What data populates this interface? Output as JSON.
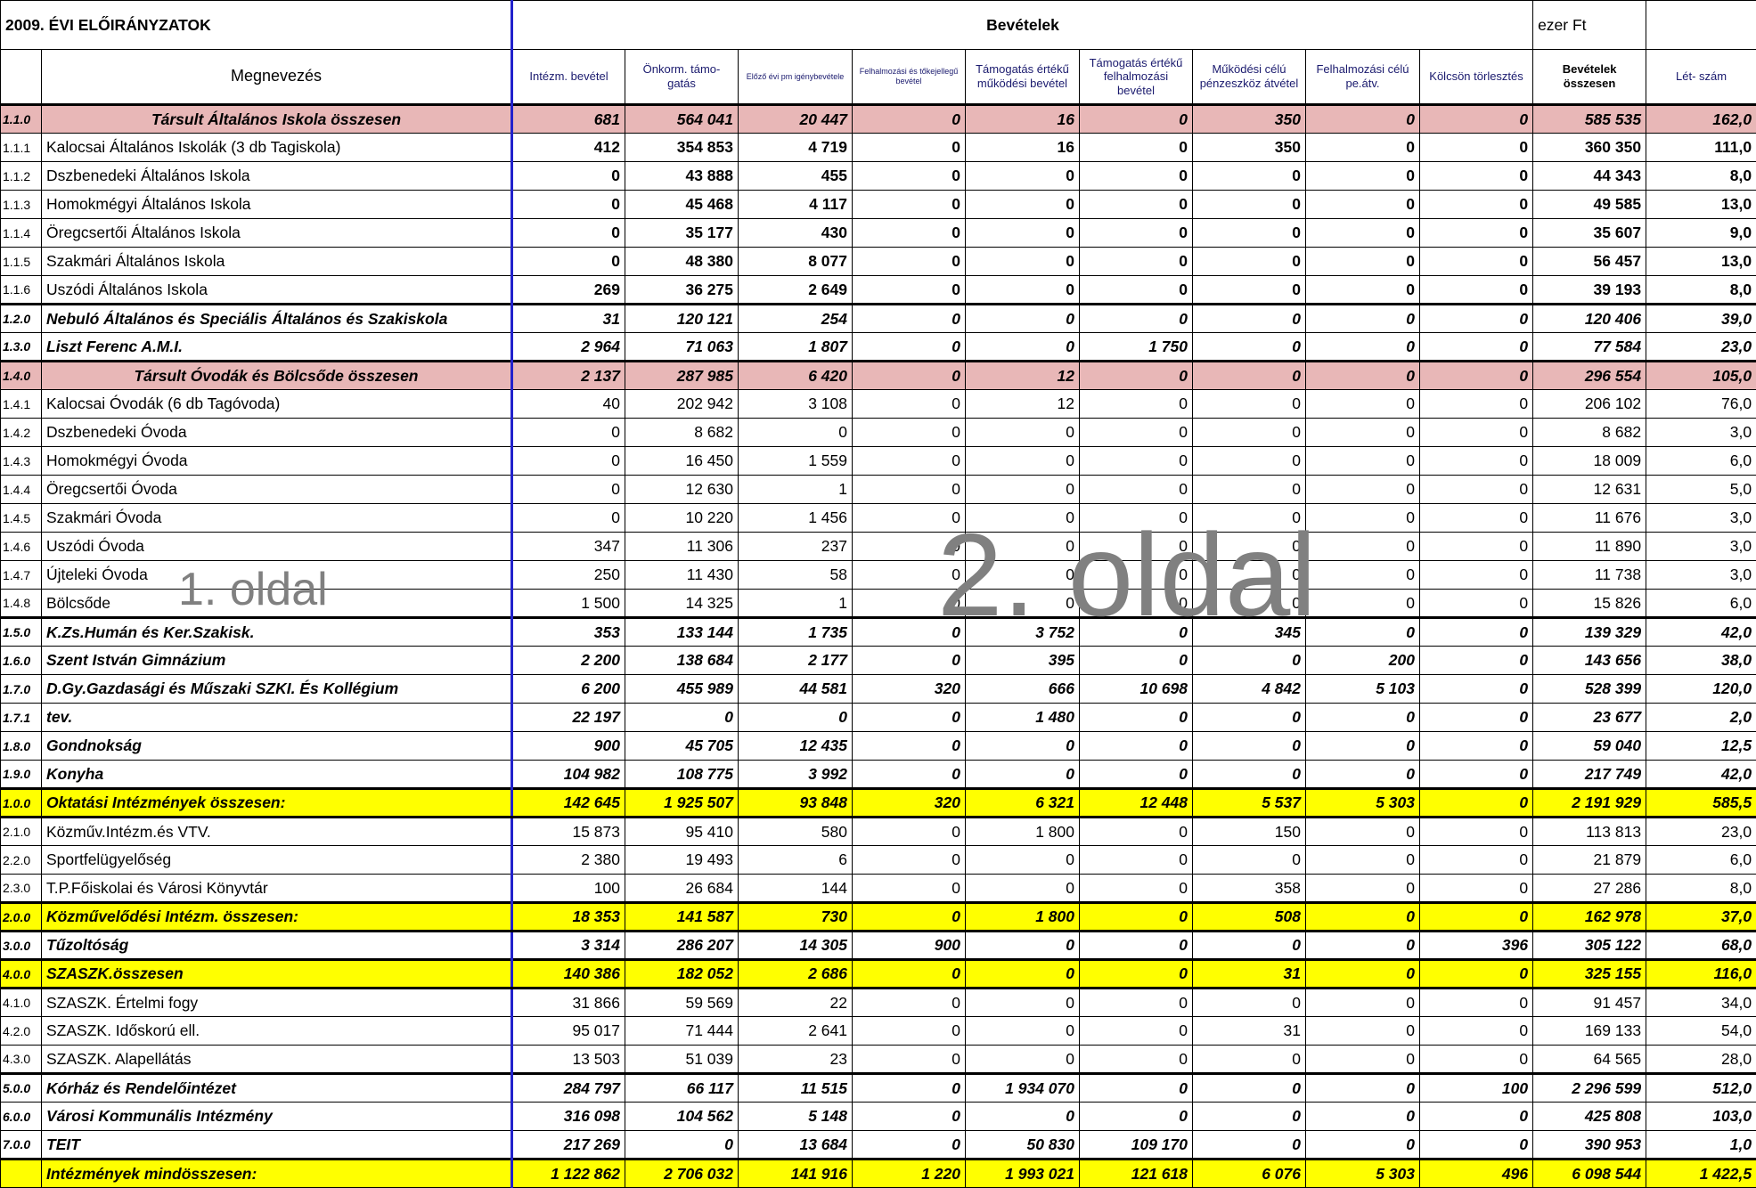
{
  "header": {
    "title": "2009. ÉVI ELŐIRÁNYZATOK",
    "section": "Bevételek",
    "unit": "ezer Ft"
  },
  "columns": {
    "name": "Megnevezés",
    "intezm": "Intézm. bevétel",
    "onkorm": "Önkorm. támo- gatás",
    "elozo": "Előző évi pm igénybevétele",
    "felh_tokejellegu": "Felhalmozási és tőkejellegű bevétel",
    "tam_mukodesi": "Támogatás értékű működési bevétel",
    "tam_felhalmozasi": "Támogatás értékű felhalmozási bevétel",
    "mukodesi_penzeszkoz": "Működési célú pénzeszköz átvétel",
    "felh_pe_atv": "Felhalmozási célú pe.átv.",
    "kolcson": "Kölcsön törlesztés",
    "osszesen": "Bevételek összesen",
    "letszam": "Lét- szám"
  },
  "rows": [
    {
      "code": "1.1.0",
      "name": "Társult Általános Iskola összesen",
      "v": [
        "681",
        "564 041",
        "20 447",
        "0",
        "16",
        "0",
        "350",
        "0",
        "0",
        "585 535",
        "162,0"
      ]
    },
    {
      "code": "1.1.1",
      "name": "Kalocsai Általános Iskolák (3 db Tagiskola)",
      "v": [
        "412",
        "354 853",
        "4 719",
        "0",
        "16",
        "0",
        "350",
        "0",
        "0",
        "360 350",
        "111,0"
      ]
    },
    {
      "code": "1.1.2",
      "name": "Dszbenedeki Általános Iskola",
      "v": [
        "0",
        "43 888",
        "455",
        "0",
        "0",
        "0",
        "0",
        "0",
        "0",
        "44 343",
        "8,0"
      ]
    },
    {
      "code": "1.1.3",
      "name": "Homokmégyi Általános Iskola",
      "v": [
        "0",
        "45 468",
        "4 117",
        "0",
        "0",
        "0",
        "0",
        "0",
        "0",
        "49 585",
        "13,0"
      ]
    },
    {
      "code": "1.1.4",
      "name": "Öregcsertői Általános Iskola",
      "v": [
        "0",
        "35 177",
        "430",
        "0",
        "0",
        "0",
        "0",
        "0",
        "0",
        "35 607",
        "9,0"
      ]
    },
    {
      "code": "1.1.5",
      "name": "Szakmári Általános Iskola",
      "v": [
        "0",
        "48 380",
        "8 077",
        "0",
        "0",
        "0",
        "0",
        "0",
        "0",
        "56 457",
        "13,0"
      ]
    },
    {
      "code": "1.1.6",
      "name": "Uszódi Általános Iskola",
      "v": [
        "269",
        "36 275",
        "2 649",
        "0",
        "0",
        "0",
        "0",
        "0",
        "0",
        "39 193",
        "8,0"
      ]
    },
    {
      "code": "1.2.0",
      "name": "Nebuló Általános és Speciális Általános és Szakiskola",
      "v": [
        "31",
        "120 121",
        "254",
        "0",
        "0",
        "0",
        "0",
        "0",
        "0",
        "120 406",
        "39,0"
      ]
    },
    {
      "code": "1.3.0",
      "name": "Liszt Ferenc A.M.I.",
      "v": [
        "2 964",
        "71 063",
        "1 807",
        "0",
        "0",
        "1 750",
        "0",
        "0",
        "0",
        "77 584",
        "23,0"
      ]
    },
    {
      "code": "1.4.0",
      "name": "Társult Óvodák és Bölcsőde összesen",
      "v": [
        "2 137",
        "287 985",
        "6 420",
        "0",
        "12",
        "0",
        "0",
        "0",
        "0",
        "296 554",
        "105,0"
      ]
    },
    {
      "code": "1.4.1",
      "name": "Kalocsai Óvodák (6 db Tagóvoda)",
      "v": [
        "40",
        "202 942",
        "3 108",
        "0",
        "12",
        "0",
        "0",
        "0",
        "0",
        "206 102",
        "76,0"
      ]
    },
    {
      "code": "1.4.2",
      "name": "Dszbenedeki Óvoda",
      "v": [
        "0",
        "8 682",
        "0",
        "0",
        "0",
        "0",
        "0",
        "0",
        "0",
        "8 682",
        "3,0"
      ]
    },
    {
      "code": "1.4.3",
      "name": "Homokmégyi Óvoda",
      "v": [
        "0",
        "16 450",
        "1 559",
        "0",
        "0",
        "0",
        "0",
        "0",
        "0",
        "18 009",
        "6,0"
      ]
    },
    {
      "code": "1.4.4",
      "name": "Öregcsertői Óvoda",
      "v": [
        "0",
        "12 630",
        "1",
        "0",
        "0",
        "0",
        "0",
        "0",
        "0",
        "12 631",
        "5,0"
      ]
    },
    {
      "code": "1.4.5",
      "name": "Szakmári Óvoda",
      "v": [
        "0",
        "10 220",
        "1 456",
        "0",
        "0",
        "0",
        "0",
        "0",
        "0",
        "11 676",
        "3,0"
      ]
    },
    {
      "code": "1.4.6",
      "name": "Uszódi Óvoda",
      "v": [
        "347",
        "11 306",
        "237",
        "0",
        "0",
        "0",
        "0",
        "0",
        "0",
        "11 890",
        "3,0"
      ]
    },
    {
      "code": "1.4.7",
      "name": "Újteleki Óvoda",
      "v": [
        "250",
        "11 430",
        "58",
        "0",
        "0",
        "0",
        "0",
        "0",
        "0",
        "11 738",
        "3,0"
      ]
    },
    {
      "code": "1.4.8",
      "name": "Bölcsőde",
      "v": [
        "1 500",
        "14 325",
        "1",
        "0",
        "0",
        "0",
        "0",
        "0",
        "0",
        "15 826",
        "6,0"
      ]
    },
    {
      "code": "1.5.0",
      "name": "K.Zs.Humán és Ker.Szakisk.",
      "v": [
        "353",
        "133 144",
        "1 735",
        "0",
        "3 752",
        "0",
        "345",
        "0",
        "0",
        "139 329",
        "42,0"
      ]
    },
    {
      "code": "1.6.0",
      "name": "Szent István Gimnázium",
      "v": [
        "2 200",
        "138 684",
        "2 177",
        "0",
        "395",
        "0",
        "0",
        "200",
        "0",
        "143 656",
        "38,0"
      ]
    },
    {
      "code": "1.7.0",
      "name": "D.Gy.Gazdasági és Műszaki SZKI. És Kollégium",
      "v": [
        "6 200",
        "455 989",
        "44 581",
        "320",
        "666",
        "10 698",
        "4 842",
        "5 103",
        "0",
        "528 399",
        "120,0"
      ]
    },
    {
      "code": "1.7.1",
      "name": "tev.",
      "v": [
        "22 197",
        "0",
        "0",
        "0",
        "1 480",
        "0",
        "0",
        "0",
        "0",
        "23 677",
        "2,0"
      ]
    },
    {
      "code": "1.8.0",
      "name": "Gondnokság",
      "v": [
        "900",
        "45 705",
        "12 435",
        "0",
        "0",
        "0",
        "0",
        "0",
        "0",
        "59 040",
        "12,5"
      ]
    },
    {
      "code": "1.9.0",
      "name": "Konyha",
      "v": [
        "104 982",
        "108 775",
        "3 992",
        "0",
        "0",
        "0",
        "0",
        "0",
        "0",
        "217 749",
        "42,0"
      ]
    },
    {
      "code": "1.0.0",
      "name": "Oktatási Intézmények összesen:",
      "v": [
        "142 645",
        "1 925 507",
        "93 848",
        "320",
        "6 321",
        "12 448",
        "5 537",
        "5 303",
        "0",
        "2 191 929",
        "585,5"
      ]
    },
    {
      "code": "2.1.0",
      "name": "Közműv.Intézm.és VTV.",
      "v": [
        "15 873",
        "95 410",
        "580",
        "0",
        "1 800",
        "0",
        "150",
        "0",
        "0",
        "113 813",
        "23,0"
      ]
    },
    {
      "code": "2.2.0",
      "name": "Sportfelügyelőség",
      "v": [
        "2 380",
        "19 493",
        "6",
        "0",
        "0",
        "0",
        "0",
        "0",
        "0",
        "21 879",
        "6,0"
      ]
    },
    {
      "code": "2.3.0",
      "name": "T.P.Főiskolai és Városi Könyvtár",
      "v": [
        "100",
        "26 684",
        "144",
        "0",
        "0",
        "0",
        "358",
        "0",
        "0",
        "27 286",
        "8,0"
      ]
    },
    {
      "code": "2.0.0",
      "name": "Közművelődési Intézm. összesen:",
      "v": [
        "18 353",
        "141 587",
        "730",
        "0",
        "1 800",
        "0",
        "508",
        "0",
        "0",
        "162 978",
        "37,0"
      ]
    },
    {
      "code": "3.0.0",
      "name": "Tűzoltóság",
      "v": [
        "3 314",
        "286 207",
        "14 305",
        "900",
        "0",
        "0",
        "0",
        "0",
        "396",
        "305 122",
        "68,0"
      ]
    },
    {
      "code": "4.0.0",
      "name": "SZASZK.összesen",
      "v": [
        "140 386",
        "182 052",
        "2 686",
        "0",
        "0",
        "0",
        "31",
        "0",
        "0",
        "325 155",
        "116,0"
      ]
    },
    {
      "code": "4.1.0",
      "name": "SZASZK. Értelmi fogy",
      "v": [
        "31 866",
        "59 569",
        "22",
        "0",
        "0",
        "0",
        "0",
        "0",
        "0",
        "91 457",
        "34,0"
      ]
    },
    {
      "code": "4.2.0",
      "name": "SZASZK. Időskorú ell.",
      "v": [
        "95 017",
        "71 444",
        "2 641",
        "0",
        "0",
        "0",
        "31",
        "0",
        "0",
        "169 133",
        "54,0"
      ]
    },
    {
      "code": "4.3.0",
      "name": "SZASZK. Alapellátás",
      "v": [
        "13 503",
        "51 039",
        "23",
        "0",
        "0",
        "0",
        "0",
        "0",
        "0",
        "64 565",
        "28,0"
      ]
    },
    {
      "code": "5.0.0",
      "name": "Kórház és Rendelőintézet",
      "v": [
        "284 797",
        "66 117",
        "11 515",
        "0",
        "1 934 070",
        "0",
        "0",
        "0",
        "100",
        "2 296 599",
        "512,0"
      ]
    },
    {
      "code": "6.0.0",
      "name": "Városi Kommunális Intézmény",
      "v": [
        "316 098",
        "104 562",
        "5 148",
        "0",
        "0",
        "0",
        "0",
        "0",
        "0",
        "425 808",
        "103,0"
      ]
    },
    {
      "code": "7.0.0",
      "name": "TEIT",
      "v": [
        "217 269",
        "0",
        "13 684",
        "0",
        "50 830",
        "109 170",
        "0",
        "0",
        "0",
        "390 953",
        "1,0"
      ]
    },
    {
      "code": "",
      "name": "Intézmények mindösszesen:",
      "v": [
        "1 122 862",
        "2 706 032",
        "141 916",
        "1 220",
        "1 993 021",
        "121 618",
        "6 076",
        "5 303",
        "496",
        "6 098 544",
        "1 422,5"
      ]
    }
  ],
  "watermarks": {
    "page1": "1. oldal",
    "page2": "2. oldal"
  },
  "colors": {
    "pink_row": "#e8b7b7",
    "yellow_highlight": "#ffff00",
    "separator_blue": "#2222cc"
  }
}
